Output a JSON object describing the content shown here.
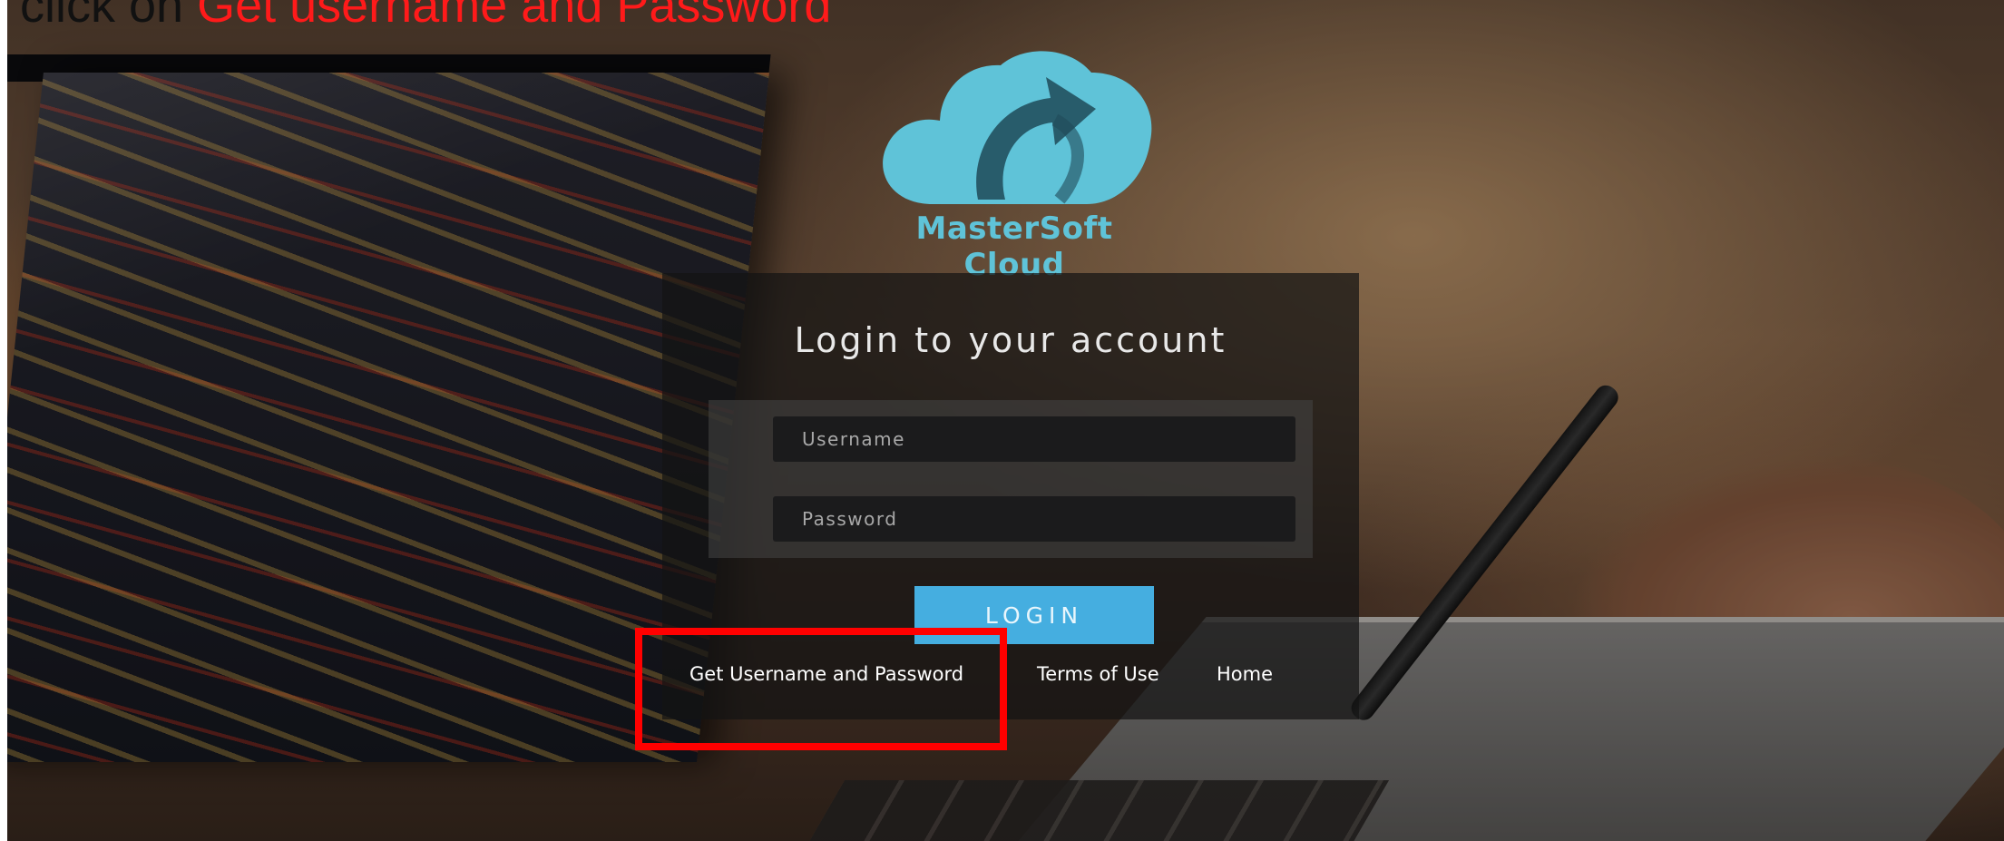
{
  "caption": {
    "lead": "click on ",
    "highlight": "Get username and Password"
  },
  "logo": {
    "icon": "cloud-arrow-icon",
    "brand": "MasterSoft Cloud",
    "color": "#5fc3d8"
  },
  "login": {
    "title": "Login to your account",
    "username_placeholder": "Username",
    "password_placeholder": "Password",
    "button_label": "LOGIN",
    "button_color": "#45aee0"
  },
  "links": {
    "get_credentials": "Get Username and Password",
    "terms": "Terms of Use",
    "home": "Home"
  },
  "annotation": {
    "color": "#ff0000"
  }
}
